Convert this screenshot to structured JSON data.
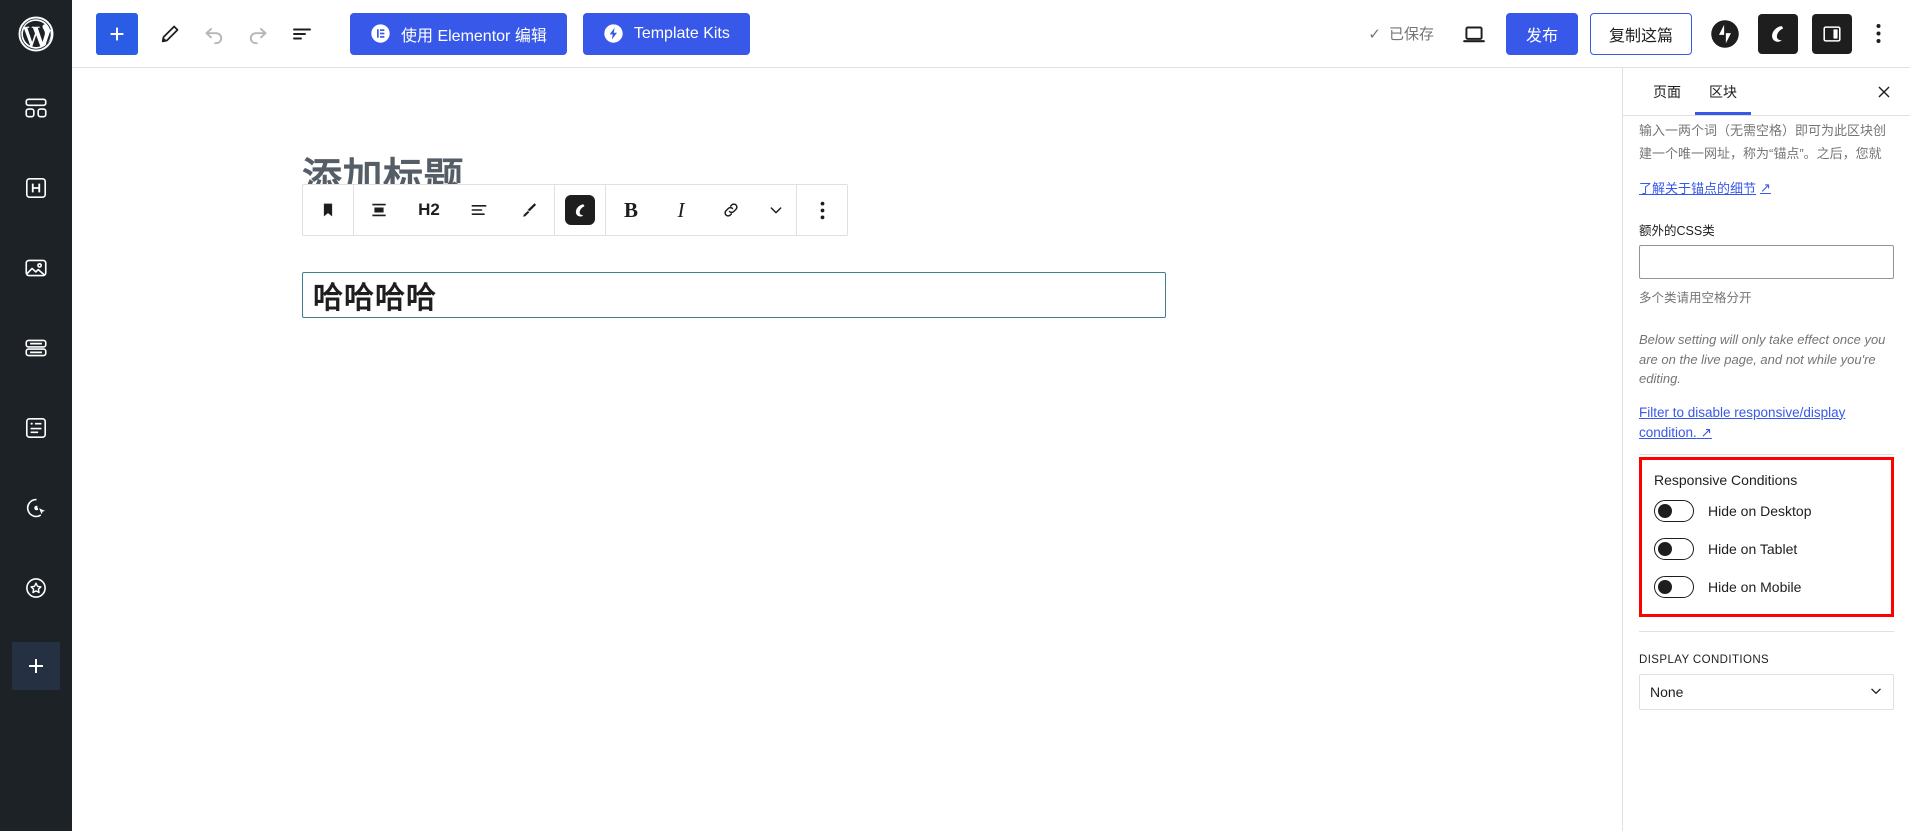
{
  "rail": {
    "logo": "wordpress-logo",
    "items": [
      {
        "icon": "dashboard-blocks-icon",
        "name": "dashboard"
      },
      {
        "icon": "heading-h-icon",
        "name": "heading"
      },
      {
        "icon": "image-icon",
        "name": "media"
      },
      {
        "icon": "stacked-bars-icon",
        "name": "layout"
      },
      {
        "icon": "document-text-icon",
        "name": "document"
      },
      {
        "icon": "cursor-click-icon",
        "name": "interactions"
      },
      {
        "icon": "star-badge-icon",
        "name": "favorites"
      }
    ],
    "add_label": "+"
  },
  "topbar": {
    "add_block_label": "+",
    "edit_pencil": "pencil-icon",
    "undo": "undo-icon",
    "redo": "redo-icon",
    "list_view": "list-view-icon",
    "elementor_label": "使用 Elementor 编辑",
    "template_kits_label": "Template Kits",
    "saved_label": "已保存",
    "saved_check": "✓",
    "preview_icon": "laptop-preview-icon",
    "publish_label": "发布",
    "duplicate_label": "复制这篇",
    "jetpack_icon": "jetpack-icon",
    "envato_icon": "envato-icon",
    "settings_panel_icon": "sidebar-toggle-icon",
    "options_icon": "kebab-menu-icon"
  },
  "editor": {
    "post_title_placeholder": "添加标题",
    "heading_text": "哈哈哈哈",
    "block_toolbar": {
      "block_type": "bookmark-block-icon",
      "align_text": "align-text-icon",
      "heading_level": "H2",
      "align_options": "text-align-icon",
      "highlight": "highlighter-icon",
      "plugin_block": "envato-block-icon",
      "bold": "B",
      "italic": "I",
      "link": "link-icon",
      "more_formats": "chevron-down-icon",
      "block_options": "kebab-menu-icon"
    }
  },
  "sidebar": {
    "tabs": [
      {
        "label": "页面",
        "active": false
      },
      {
        "label": "区块",
        "active": true
      }
    ],
    "close_label": "✕",
    "anchor_note": "输入一两个词（无需空格）即可为此区块创建一个唯一网址，称为“锚点”。之后，您就可以直接链接至页面的此部分。",
    "anchor_link": "了解关于锚点的细节",
    "external_glyph": "↗",
    "css_class_label": "额外的CSS类",
    "css_class_value": "",
    "css_class_placeholder": "",
    "css_class_help": "多个类请用空格分开",
    "live_note": "Below setting will only take effect once you are on the live page, and not while you're editing.",
    "filter_link": "Filter to disable responsive/display condition.",
    "responsive": {
      "title": "Responsive Conditions",
      "highlight_color": "#ff0000",
      "toggles": [
        {
          "label": "Hide on Desktop",
          "on": false
        },
        {
          "label": "Hide on Tablet",
          "on": false
        },
        {
          "label": "Hide on Mobile",
          "on": false
        }
      ]
    },
    "display_conditions": {
      "title": "DISPLAY CONDITIONS",
      "selected": "None",
      "chevron": "⌄"
    }
  },
  "colors": {
    "brand_blue": "#3858e9",
    "rail_dark": "#1d2227",
    "block_border": "#3f7f8f",
    "alert_red": "#ff0000"
  }
}
